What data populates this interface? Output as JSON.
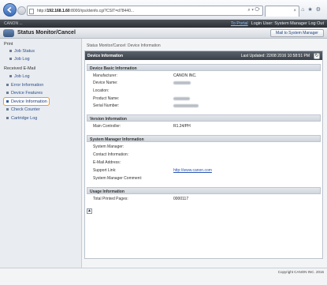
{
  "browser": {
    "url_prefix": "http://",
    "url_host": "192.168.1.60",
    "url_rest": ":8000/rps/dvinfo.cgi?CSIT=d78440..."
  },
  "header": {
    "device_name": "CANON ...",
    "portal": "To Portal",
    "login_user": "Login User: System Manager",
    "log_out": "Log Out",
    "app_title": "Status Monitor/Cancel",
    "mail_button": "Mail to System Manager"
  },
  "sidebar": {
    "print_head": "Print",
    "job_status": "Job Status",
    "job_log_print": "Job Log",
    "received_head": "Received E-Mail",
    "job_log_mail": "Job Log",
    "error_info": "Error Information",
    "device_features": "Device Features",
    "device_info": "Device Information",
    "check_counter": "Check Counter",
    "cartridge_log": "Cartridge Log"
  },
  "main": {
    "breadcrumb": "Status Monitor/Cancel: Device Information",
    "panel_title": "Device Information",
    "last_updated": "Last Updated: 22/08 2016 10:58:51 PM",
    "basic_head": "Device Basic Information",
    "manufacturer_label": "Manufacturer:",
    "manufacturer_value": "CANON INC.",
    "device_name_label": "Device Name:",
    "location_label": "Location:",
    "product_name_label": "Product Name:",
    "serial_label": "Serial Number:",
    "version_head": "Version Information",
    "main_controller_label": "Main Controller:",
    "main_controller_value": "R1.24/PH",
    "sysmgr_head": "System Manager Information",
    "sys_manager_label": "System Manager:",
    "contact_label": "Contact Information:",
    "email_label": "E-Mail Address:",
    "support_label": "Support Link:",
    "support_value": "http://www.canon.com",
    "comment_label": "System Manager Comment:",
    "usage_head": "Usage Information",
    "total_pages_label": "Total Printed Pages:",
    "total_pages_value": "0000117"
  },
  "footer": {
    "copyright": "Copyright CANON INC. 2016"
  }
}
